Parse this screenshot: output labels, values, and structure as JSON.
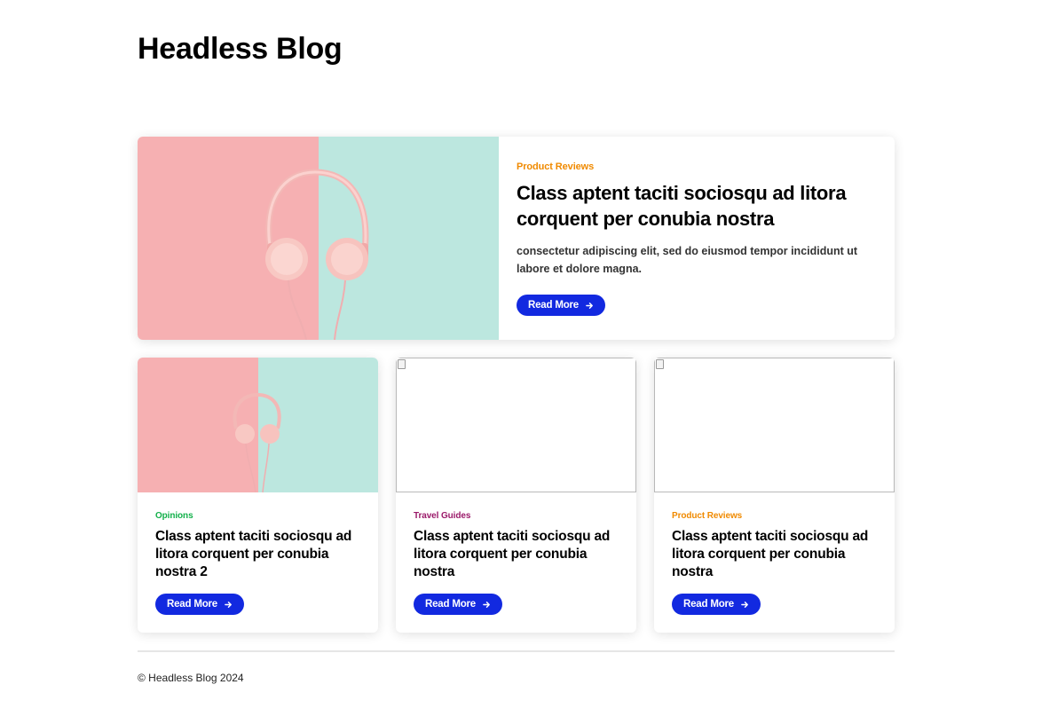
{
  "site": {
    "title": "Headless Blog"
  },
  "colors": {
    "accent": "#1229e0",
    "category_product_reviews": "#f08a00",
    "category_opinions": "#12b04a",
    "category_travel_guides": "#9b1a6a",
    "image_pink": "#f6b0b2",
    "image_mint": "#bce7df"
  },
  "featured": {
    "category": "Product Reviews",
    "category_color": "#f08a00",
    "title": "Class aptent taciti sociosqu ad litora corquent per conubia nostra",
    "excerpt": "consectetur adipiscing elit, sed do eiusmod tempor incididunt ut labore et dolore magna.",
    "button_label": "Read More",
    "image": "headphones-image"
  },
  "posts": [
    {
      "category": "Opinions",
      "category_color": "#12b04a",
      "title": "Class aptent taciti sociosqu ad litora corquent per conubia nostra 2",
      "button_label": "Read More",
      "image": "headphones-image"
    },
    {
      "category": "Travel Guides",
      "category_color": "#9b1a6a",
      "title": "Class aptent taciti sociosqu ad litora corquent per conubia nostra",
      "button_label": "Read More",
      "image": "broken-image"
    },
    {
      "category": "Product Reviews",
      "category_color": "#f08a00",
      "title": "Class aptent taciti sociosqu ad litora corquent per conubia nostra",
      "button_label": "Read More",
      "image": "broken-image"
    }
  ],
  "footer": {
    "text": "© Headless Blog 2024"
  }
}
